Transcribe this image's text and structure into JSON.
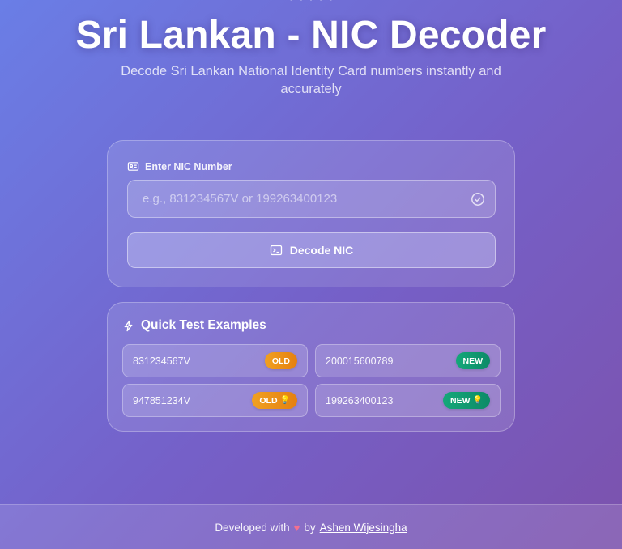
{
  "header": {
    "top_fragment": "· · · · ·",
    "title": "Sri Lankan - NIC Decoder",
    "subtitle": "Decode Sri Lankan National Identity Card numbers instantly and accurately"
  },
  "decoder": {
    "label": "Enter NIC Number",
    "input_value": "",
    "input_placeholder": "e.g., 831234567V or 199263400123",
    "button_label": "Decode NIC"
  },
  "examples": {
    "title": "Quick Test Examples",
    "items": [
      {
        "number": "831234567V",
        "badge": "OLD",
        "badge_type": "old",
        "bulb": false
      },
      {
        "number": "200015600789",
        "badge": "NEW",
        "badge_type": "new",
        "bulb": false
      },
      {
        "number": "947851234V",
        "badge": "OLD",
        "badge_type": "old",
        "bulb": true
      },
      {
        "number": "199263400123",
        "badge": "NEW",
        "badge_type": "new",
        "bulb": true
      }
    ]
  },
  "footer": {
    "prefix": "Developed with",
    "heart": "♥",
    "by": "by",
    "author": "Ashen Wijesingha"
  },
  "colors": {
    "old_badge": "#e5800f",
    "new_badge": "#0c8a67",
    "heart": "#f4708f"
  },
  "icons": {
    "label_icon": "id-card-icon",
    "input_icon": "check-circle-icon",
    "button_icon": "terminal-icon",
    "examples_icon": "lightning-icon",
    "bulb_icon": "lightbulb-icon"
  }
}
